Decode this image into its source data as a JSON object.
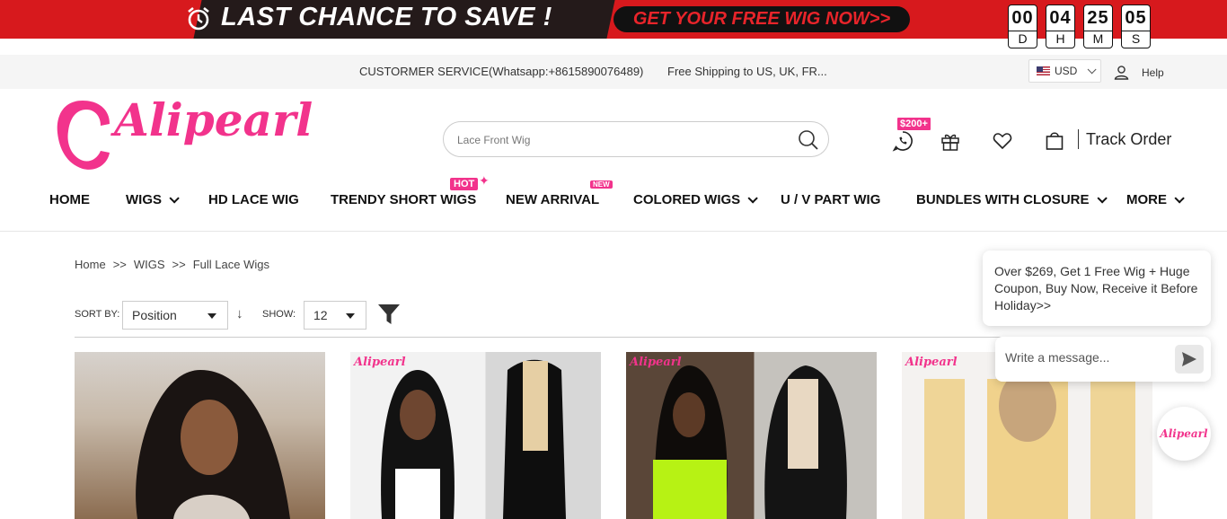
{
  "promo": {
    "title": "LAST CHANCE TO SAVE !",
    "cta": "GET YOUR FREE WIG NOW>>",
    "countdown": [
      {
        "value": "00",
        "unit": "D"
      },
      {
        "value": "04",
        "unit": "H"
      },
      {
        "value": "25",
        "unit": "M"
      },
      {
        "value": "05",
        "unit": "S"
      }
    ],
    "colors": {
      "banner": "#d7191d",
      "cta_text": "#e8242a"
    }
  },
  "topbar": {
    "service": "CUSTORMER SERVICE(Whatsapp:+8615890076489)",
    "shipping": "Free Shipping to US, UK, FR...",
    "currency": "USD",
    "help": "Help"
  },
  "header": {
    "logo_text": "Alipearl",
    "search_placeholder": "Lace Front Wig",
    "whatsapp_badge": "$200+",
    "track_order": "Track Order",
    "brand_color": "#f2338c"
  },
  "nav": {
    "items": [
      {
        "label": "HOME",
        "dropdown": false
      },
      {
        "label": "WIGS",
        "dropdown": true
      },
      {
        "label": "HD LACE WIG",
        "dropdown": false
      },
      {
        "label": "TRENDY SHORT WIGS",
        "dropdown": false
      },
      {
        "label": "NEW ARRIVAL",
        "dropdown": false
      },
      {
        "label": "COLORED WIGS",
        "dropdown": true
      },
      {
        "label": "U / V PART WIG",
        "dropdown": false
      },
      {
        "label": "BUNDLES WITH CLOSURE",
        "dropdown": true
      },
      {
        "label": "MORE",
        "dropdown": true
      }
    ],
    "hot_tag": "HOT",
    "new_tag": "NEW"
  },
  "breadcrumb": {
    "items": [
      "Home",
      "WIGS",
      "Full Lace Wigs"
    ],
    "separator": ">>"
  },
  "toolbar": {
    "sort_label": "SORT BY:",
    "sort_value": "Position",
    "show_label": "SHOW:",
    "show_value": "12"
  },
  "products": [
    {
      "brand": ""
    },
    {
      "brand": "Alipearl"
    },
    {
      "brand": "Alipearl"
    },
    {
      "brand": "Alipearl"
    }
  ],
  "chat": {
    "message": "Over $269, Get 1 Free Wig + Huge Coupon, Buy Now, Receive it Before Holiday>>",
    "input_placeholder": "Write a message...",
    "launcher_label": "Alipearl"
  }
}
